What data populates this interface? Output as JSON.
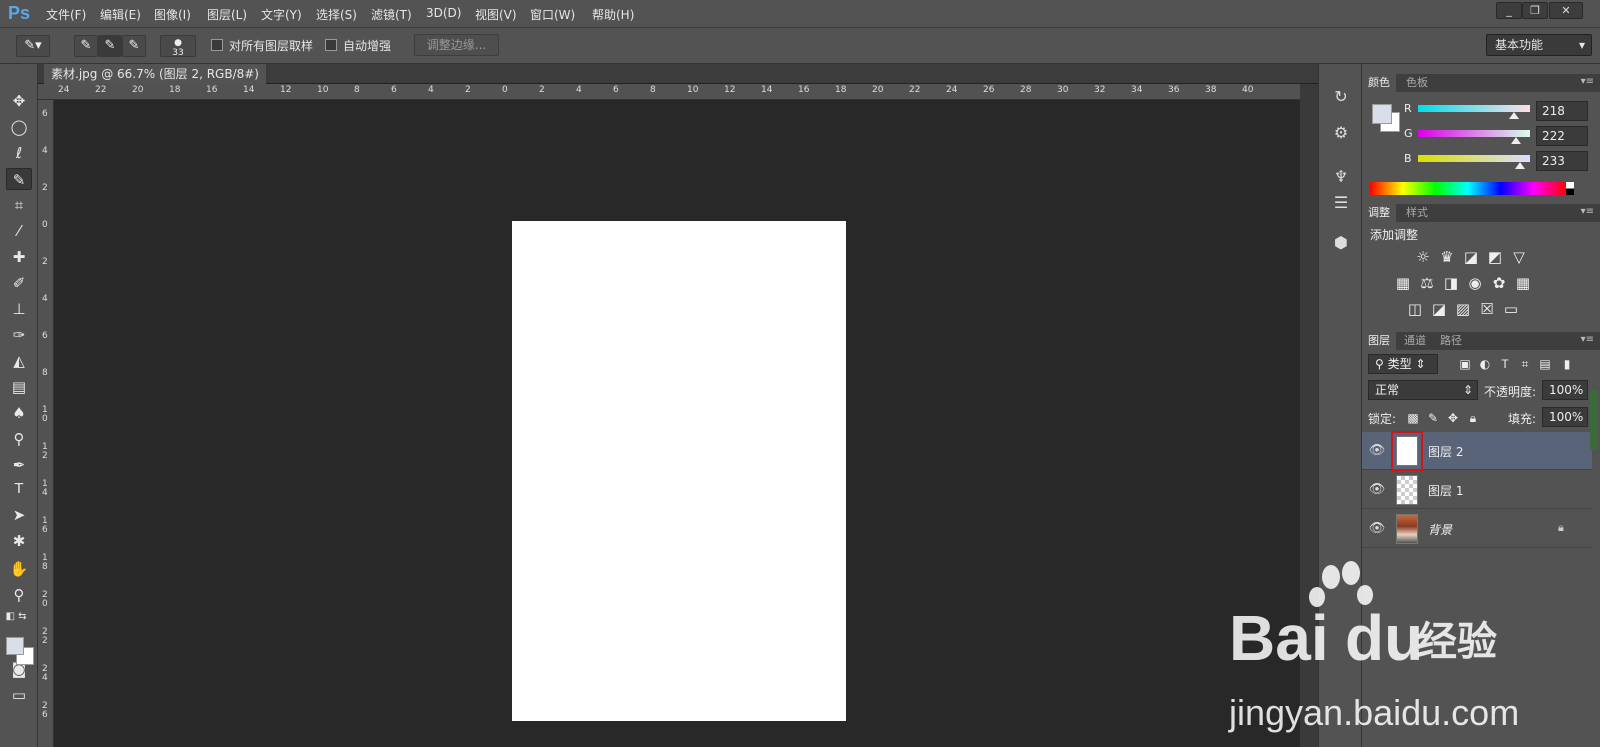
{
  "app": {
    "logo": "Ps"
  },
  "menu": [
    "文件(F)",
    "编辑(E)",
    "图像(I)",
    "图层(L)",
    "文字(Y)",
    "选择(S)",
    "滤镜(T)",
    "3D(D)",
    "视图(V)",
    "窗口(W)",
    "帮助(H)"
  ],
  "options": {
    "brush_size": "33",
    "sample_all_label": "对所有图层取样",
    "auto_enhance_label": "自动增强",
    "refine_label": "调整边缘...",
    "workspace": "基本功能"
  },
  "document": {
    "tab_title": "素材.jpg @ 66.7% (图层 2, RGB/8#) *",
    "close": "×"
  },
  "ruler": {
    "h": [
      "24",
      "22",
      "20",
      "18",
      "16",
      "14",
      "12",
      "10",
      "8",
      "6",
      "4",
      "2",
      "0",
      "2",
      "4",
      "6",
      "8",
      "10",
      "12",
      "14",
      "16",
      "18",
      "20",
      "22",
      "24",
      "26",
      "28",
      "30",
      "32",
      "34",
      "36",
      "38",
      "40"
    ],
    "v": [
      "6",
      "4",
      "2",
      "0",
      "2",
      "4",
      "6",
      "8",
      "1 0",
      "1 2",
      "1 4",
      "1 6",
      "1 8",
      "2 0",
      "2 2",
      "2 4",
      "2 6"
    ]
  },
  "color_panel": {
    "tabs": [
      "颜色",
      "色板"
    ],
    "channels": [
      {
        "label": "R",
        "value": "218",
        "fraction": 0.855
      },
      {
        "label": "G",
        "value": "222",
        "fraction": 0.871
      },
      {
        "label": "B",
        "value": "233",
        "fraction": 0.914
      }
    ],
    "foreground": "#dadee9",
    "background": "#ffffff"
  },
  "adjust_panel": {
    "tabs": [
      "调整",
      "样式"
    ],
    "heading": "添加调整"
  },
  "layers_panel": {
    "tabs": [
      "图层",
      "通道",
      "路径"
    ],
    "filter_kind": "类型",
    "blend_mode": "正常",
    "opacity_label": "不透明度:",
    "opacity": "100%",
    "lock_label": "锁定:",
    "fill_label": "填充:",
    "fill": "100%",
    "layers": [
      {
        "name": "图层 2",
        "selected": true
      },
      {
        "name": "图层 1",
        "selected": false
      },
      {
        "name": "背景",
        "selected": false,
        "locked": true
      }
    ]
  },
  "watermark": {
    "brand": "Bai",
    "brand_cn": "经验",
    "url": "jingyan.baidu.com"
  },
  "colors": {
    "accent": "#5aa8e8",
    "highlight": "#d0161b",
    "selected_layer": "#5a6478"
  }
}
